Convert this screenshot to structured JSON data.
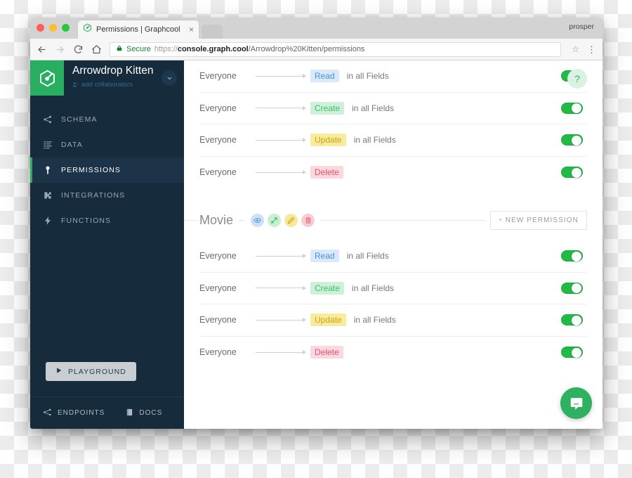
{
  "browser": {
    "tab": {
      "title": "Permissions | Graphcool",
      "favicon": "graphcool-logo-icon",
      "close": "×"
    },
    "profile": "prosper",
    "nav": {
      "back": "←",
      "forward": "→",
      "reload": "⟳",
      "home": "⌂"
    },
    "omnibox": {
      "lock": "🔒",
      "secure_label": "Secure",
      "url_scheme": "https://",
      "url_domain": "console.graph.cool",
      "url_path": "/Arrowdrop%20Kitten/permissions",
      "star": "☆",
      "menu": "⋮"
    }
  },
  "sidebar": {
    "project": {
      "name": "Arrowdrop Kitten",
      "collaborators_label": "add collaborators",
      "caret": "⌄"
    },
    "items": [
      {
        "label": "SCHEMA",
        "icon": "schema-icon",
        "active": false
      },
      {
        "label": "DATA",
        "icon": "data-icon",
        "active": false
      },
      {
        "label": "PERMISSIONS",
        "icon": "key-icon",
        "active": true
      },
      {
        "label": "INTEGRATIONS",
        "icon": "puzzle-icon",
        "active": false
      },
      {
        "label": "FUNCTIONS",
        "icon": "bolt-icon",
        "active": false
      }
    ],
    "playground": {
      "label": "PLAYGROUND",
      "icon": "play-icon"
    },
    "footer": [
      {
        "label": "ENDPOINTS",
        "icon": "endpoints-icon"
      },
      {
        "label": "DOCS",
        "icon": "docs-icon"
      }
    ]
  },
  "main": {
    "help_badge": "?",
    "groups": [
      {
        "name": null,
        "rows": [
          {
            "who": "Everyone",
            "operation": "Read",
            "op_class": "read",
            "scope": "in all Fields",
            "enabled": true
          },
          {
            "who": "Everyone",
            "operation": "Create",
            "op_class": "create",
            "scope": "in all Fields",
            "enabled": true
          },
          {
            "who": "Everyone",
            "operation": "Update",
            "op_class": "update",
            "scope": "in all Fields",
            "enabled": true
          },
          {
            "who": "Everyone",
            "operation": "Delete",
            "op_class": "delete",
            "scope": "",
            "enabled": true
          }
        ]
      },
      {
        "name": "Movie",
        "new_permission_label": "NEW PERMISSION",
        "new_permission_plus": "+",
        "icons": [
          {
            "name": "eye-icon",
            "class": "read"
          },
          {
            "name": "create-icon",
            "class": "create"
          },
          {
            "name": "pencil-icon",
            "class": "update"
          },
          {
            "name": "trash-icon",
            "class": "delete"
          }
        ],
        "rows": [
          {
            "who": "Everyone",
            "operation": "Read",
            "op_class": "read",
            "scope": "in all Fields",
            "enabled": true
          },
          {
            "who": "Everyone",
            "operation": "Create",
            "op_class": "create",
            "scope": "in all Fields",
            "enabled": true
          },
          {
            "who": "Everyone",
            "operation": "Update",
            "op_class": "update",
            "scope": "in all Fields",
            "enabled": true
          },
          {
            "who": "Everyone",
            "operation": "Delete",
            "op_class": "delete",
            "scope": "",
            "enabled": true
          }
        ]
      }
    ],
    "intercom": "intercom-chat-icon"
  },
  "colors": {
    "brand_green": "#27ae60",
    "toggle_green": "#21ba45",
    "sidebar_bg": "#162b3c",
    "sidebar_active": "#1d3448",
    "read_blue": "#4a90d9",
    "create_green": "#3fbe6d",
    "update_yellow": "#c8a219",
    "delete_red": "#e0536a"
  }
}
